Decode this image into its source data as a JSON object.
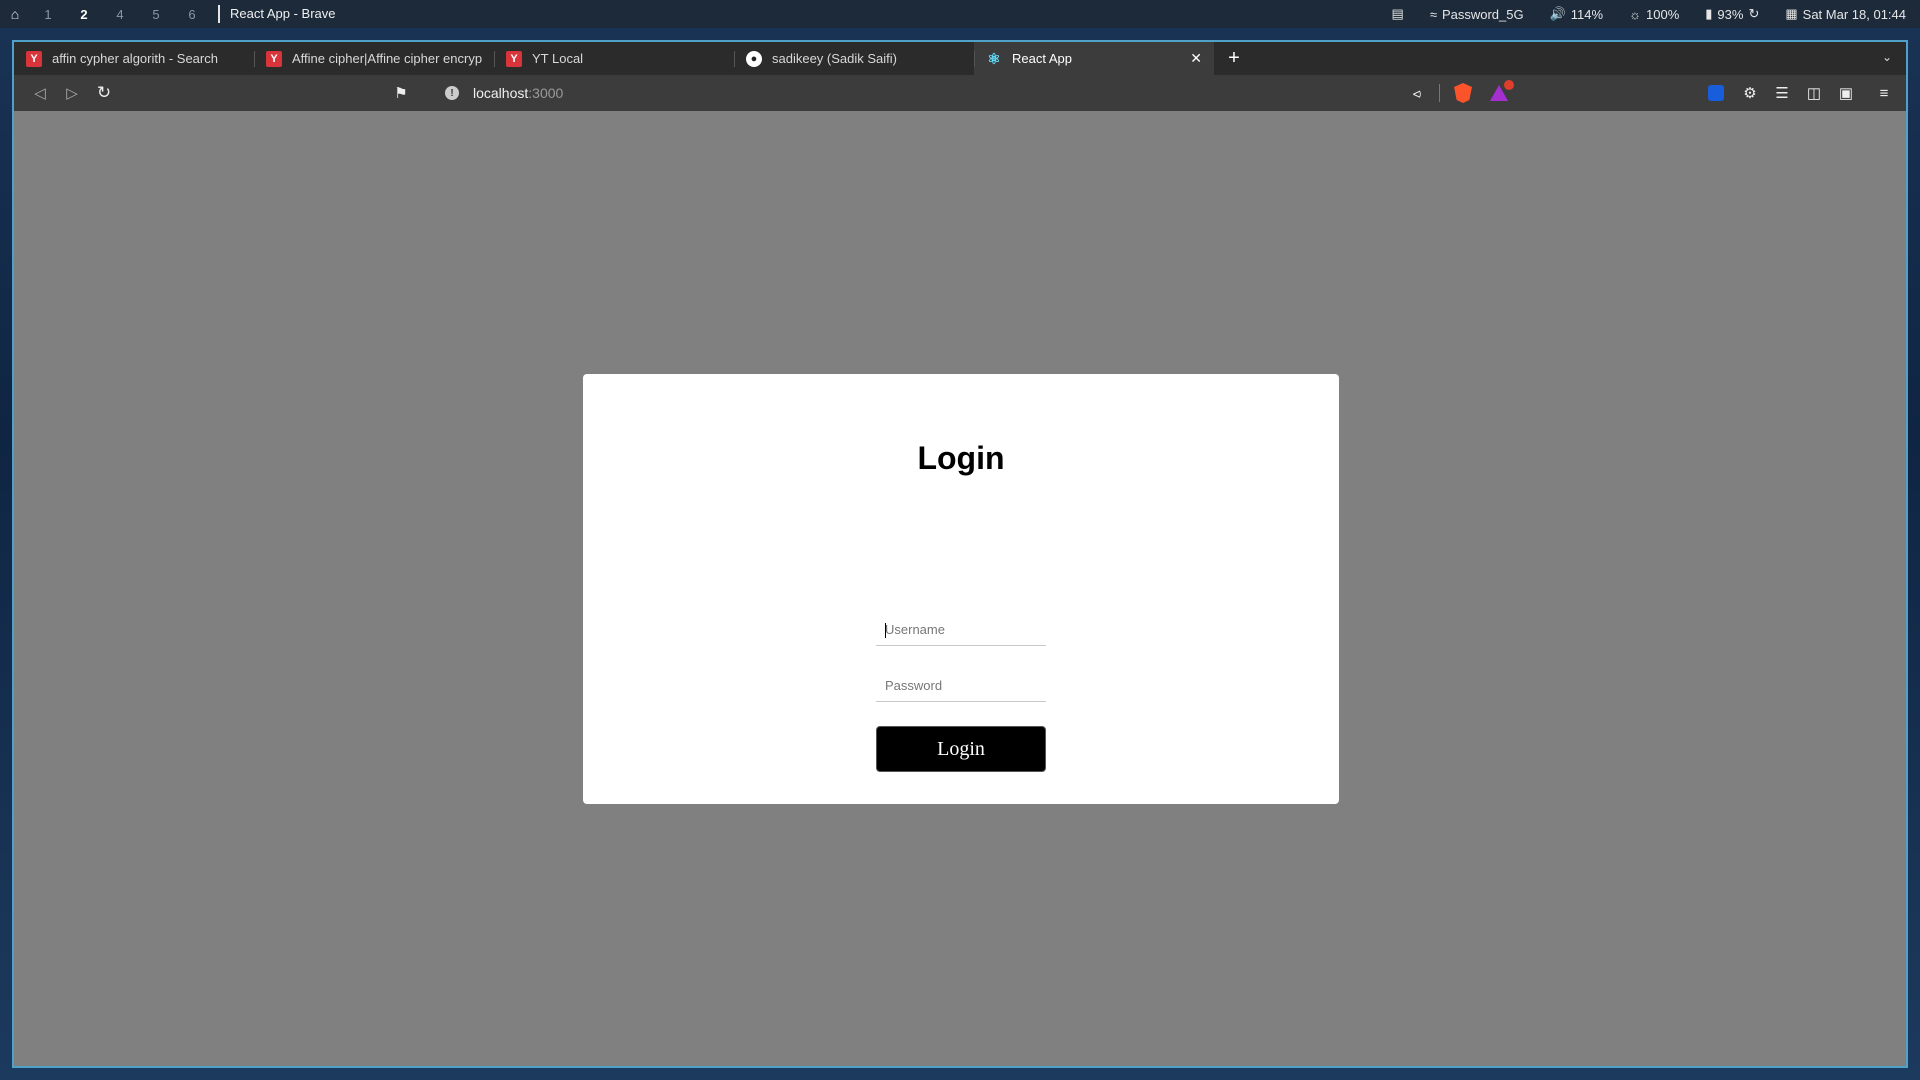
{
  "topbar": {
    "workspaces": [
      "1",
      "2",
      "4",
      "5",
      "6"
    ],
    "active_workspace": "2",
    "window_title": "React App - Brave",
    "wifi": "Password_5G",
    "volume": "114%",
    "brightness": "100%",
    "battery": "93%",
    "datetime": "Sat Mar 18, 01:44"
  },
  "tabs": [
    {
      "label": "affin cypher algorith - Search",
      "icon": "y-search-icon"
    },
    {
      "label": "Affine cipher|Affine cipher encryptic",
      "icon": "y-search-icon"
    },
    {
      "label": "YT Local",
      "icon": "y-search-icon"
    },
    {
      "label": "sadikeey (Sadik Saifi)",
      "icon": "github-icon"
    },
    {
      "label": "React App",
      "icon": "react-icon",
      "active": true
    }
  ],
  "address": {
    "host": "localhost",
    "port": ":3000"
  },
  "page": {
    "heading": "Login",
    "username_placeholder": "Username",
    "password_placeholder": "Password",
    "login_button": "Login"
  },
  "colors": {
    "page_background": "#808080",
    "card_background": "#ffffff",
    "button_background": "#000000",
    "window_border": "#4fa1c9"
  }
}
